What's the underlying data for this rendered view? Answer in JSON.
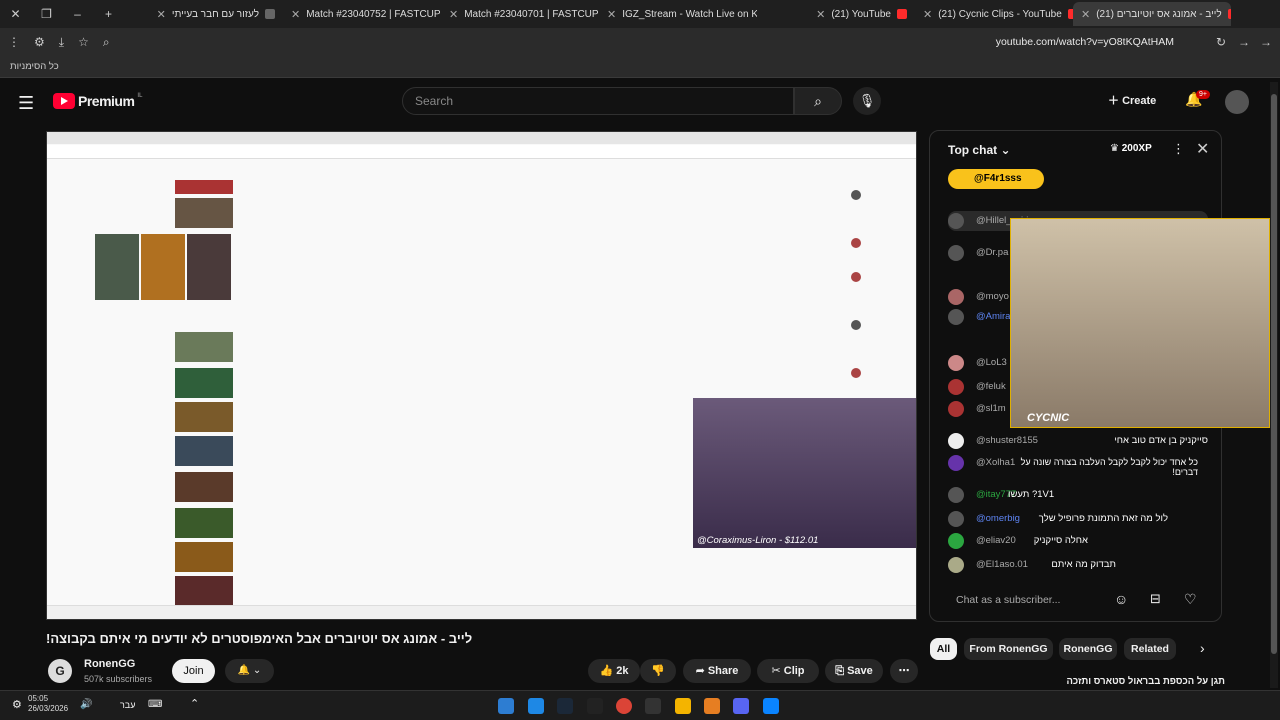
{
  "browser": {
    "tabs": [
      {
        "label": "לעזור עם חבר בעייתי"
      },
      {
        "label": "Match #23040752 | FASTCUP"
      },
      {
        "label": "Match #23040701 | FASTCUP"
      },
      {
        "label": "IGZ_Stream - Watch Live on Ki..."
      },
      {
        "label": "(21) YouTube"
      },
      {
        "label": "(21) Cycnic Clips - YouTube"
      },
      {
        "label": "(21) לייב - אמונג אס יוטיוברים"
      }
    ],
    "url": "youtube.com/watch?v=yO8tKQAtHAM",
    "bookmarks_label": "כל הסימניות"
  },
  "youtube": {
    "logo_text": "Premium",
    "logo_region": "IL",
    "search_placeholder": "Search",
    "create_label": "Create",
    "notif_badge": "9+"
  },
  "video": {
    "title": "לייב - אמונג אס יוטיוברים אבל האימפוסטרים לא יודעים מי איתם בקבוצה!",
    "channel": "RonenGG",
    "subscribers": "507k subscribers",
    "join_label": "Join",
    "likes": "2k",
    "share_label": "Share",
    "clip_label": "Clip",
    "save_label": "Save",
    "cam_label": "@Coraximus-Liron - $112.01"
  },
  "chat": {
    "header": "Top chat",
    "xp": "200XP",
    "pinned_user": "@F4r1sss",
    "cam_label": "CYCNIC",
    "input_placeholder": "Chat as a subscriber...",
    "messages": [
      {
        "user": "@Hillel_sviri",
        "text": ""
      },
      {
        "user": "@Dr.pa",
        "text": ""
      },
      {
        "user": "@moyo",
        "text": ""
      },
      {
        "user": "@Amira",
        "text": ""
      },
      {
        "user": "@LoL3",
        "text": ""
      },
      {
        "user": "@feluk",
        "text": ""
      },
      {
        "user": "@sl1m",
        "text": ""
      },
      {
        "user": "@shuster8155",
        "text": "סייקניק בן אדם טוב אחי"
      },
      {
        "user": "@Xolha1",
        "text": "כל אחד יכול לקבל לקבל העלבה בצורה שונה על דברים!"
      },
      {
        "user": "@itay777",
        "text": "1V1? תעשו"
      },
      {
        "user": "@omerbig",
        "text": "לול מה זאת התמונת פרופיל שלך"
      },
      {
        "user": "@eliav20",
        "text": "אחלה סייקניק"
      },
      {
        "user": "@El1aso.01",
        "text": "תבדוק מה איתם"
      }
    ]
  },
  "chips": [
    "All",
    "From RonenGG",
    "RonenGG",
    "Related"
  ],
  "recommended_title": "תגן על הכספת בבראול סטארס ותזכה",
  "taskbar": {
    "time": "05:05",
    "date": "26/03/2026",
    "lang": "עבר"
  }
}
